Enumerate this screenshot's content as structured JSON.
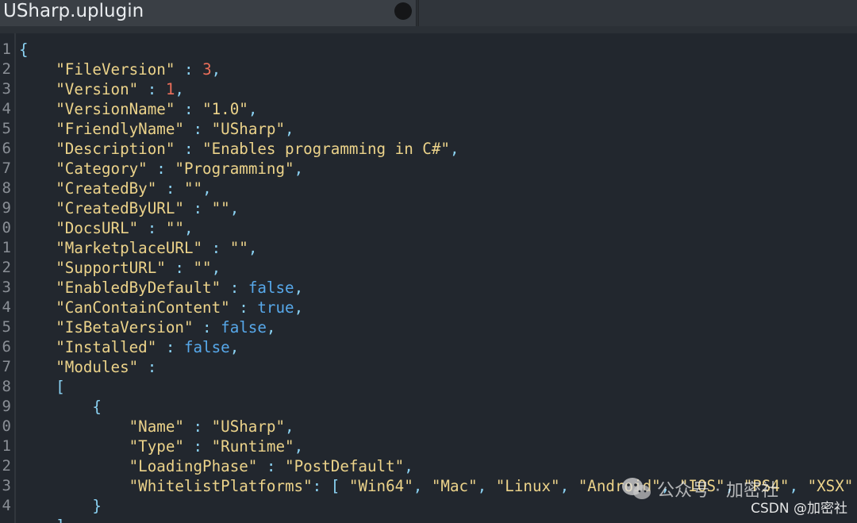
{
  "tab": {
    "title": "USharp.uplugin"
  },
  "editor": {
    "line_numbers": [
      "1",
      "2",
      "3",
      "4",
      "5",
      "6",
      "7",
      "8",
      "9",
      "0",
      "1",
      "2",
      "3",
      "4",
      "5",
      "6",
      "7",
      "8",
      "9",
      "0",
      "1",
      "2",
      "3",
      "4"
    ],
    "lines": [
      [
        {
          "t": "{",
          "c": "q"
        }
      ],
      [
        {
          "t": "    ",
          "c": ""
        },
        {
          "t": "\"FileVersion\"",
          "c": "k"
        },
        {
          "t": " : ",
          "c": "q"
        },
        {
          "t": "3",
          "c": "n"
        },
        {
          "t": ",",
          "c": "q"
        }
      ],
      [
        {
          "t": "    ",
          "c": ""
        },
        {
          "t": "\"Version\"",
          "c": "k"
        },
        {
          "t": " : ",
          "c": "q"
        },
        {
          "t": "1",
          "c": "n"
        },
        {
          "t": ",",
          "c": "q"
        }
      ],
      [
        {
          "t": "    ",
          "c": ""
        },
        {
          "t": "\"VersionName\"",
          "c": "k"
        },
        {
          "t": " : ",
          "c": "q"
        },
        {
          "t": "\"1.0\"",
          "c": "s"
        },
        {
          "t": ",",
          "c": "q"
        }
      ],
      [
        {
          "t": "    ",
          "c": ""
        },
        {
          "t": "\"FriendlyName\"",
          "c": "k"
        },
        {
          "t": " : ",
          "c": "q"
        },
        {
          "t": "\"USharp\"",
          "c": "s"
        },
        {
          "t": ",",
          "c": "q"
        }
      ],
      [
        {
          "t": "    ",
          "c": ""
        },
        {
          "t": "\"Description\"",
          "c": "k"
        },
        {
          "t": " : ",
          "c": "q"
        },
        {
          "t": "\"Enables programming in C#\"",
          "c": "s"
        },
        {
          "t": ",",
          "c": "q"
        }
      ],
      [
        {
          "t": "    ",
          "c": ""
        },
        {
          "t": "\"Category\"",
          "c": "k"
        },
        {
          "t": " : ",
          "c": "q"
        },
        {
          "t": "\"Programming\"",
          "c": "s"
        },
        {
          "t": ",",
          "c": "q"
        }
      ],
      [
        {
          "t": "    ",
          "c": ""
        },
        {
          "t": "\"CreatedBy\"",
          "c": "k"
        },
        {
          "t": " : ",
          "c": "q"
        },
        {
          "t": "\"\"",
          "c": "s"
        },
        {
          "t": ",",
          "c": "q"
        }
      ],
      [
        {
          "t": "    ",
          "c": ""
        },
        {
          "t": "\"CreatedByURL\"",
          "c": "k"
        },
        {
          "t": " : ",
          "c": "q"
        },
        {
          "t": "\"\"",
          "c": "s"
        },
        {
          "t": ",",
          "c": "q"
        }
      ],
      [
        {
          "t": "    ",
          "c": ""
        },
        {
          "t": "\"DocsURL\"",
          "c": "k"
        },
        {
          "t": " : ",
          "c": "q"
        },
        {
          "t": "\"\"",
          "c": "s"
        },
        {
          "t": ",",
          "c": "q"
        }
      ],
      [
        {
          "t": "    ",
          "c": ""
        },
        {
          "t": "\"MarketplaceURL\"",
          "c": "k"
        },
        {
          "t": " : ",
          "c": "q"
        },
        {
          "t": "\"\"",
          "c": "s"
        },
        {
          "t": ",",
          "c": "q"
        }
      ],
      [
        {
          "t": "    ",
          "c": ""
        },
        {
          "t": "\"SupportURL\"",
          "c": "k"
        },
        {
          "t": " : ",
          "c": "q"
        },
        {
          "t": "\"\"",
          "c": "s"
        },
        {
          "t": ",",
          "c": "q"
        }
      ],
      [
        {
          "t": "    ",
          "c": ""
        },
        {
          "t": "\"EnabledByDefault\"",
          "c": "k"
        },
        {
          "t": " : ",
          "c": "q"
        },
        {
          "t": "false",
          "c": "b"
        },
        {
          "t": ",",
          "c": "q"
        }
      ],
      [
        {
          "t": "    ",
          "c": ""
        },
        {
          "t": "\"CanContainContent\"",
          "c": "k"
        },
        {
          "t": " : ",
          "c": "q"
        },
        {
          "t": "true",
          "c": "b"
        },
        {
          "t": ",",
          "c": "q"
        }
      ],
      [
        {
          "t": "    ",
          "c": ""
        },
        {
          "t": "\"IsBetaVersion\"",
          "c": "k"
        },
        {
          "t": " : ",
          "c": "q"
        },
        {
          "t": "false",
          "c": "b"
        },
        {
          "t": ",",
          "c": "q"
        }
      ],
      [
        {
          "t": "    ",
          "c": ""
        },
        {
          "t": "\"Installed\"",
          "c": "k"
        },
        {
          "t": " : ",
          "c": "q"
        },
        {
          "t": "false",
          "c": "b"
        },
        {
          "t": ",",
          "c": "q"
        }
      ],
      [
        {
          "t": "    ",
          "c": ""
        },
        {
          "t": "\"Modules\"",
          "c": "k"
        },
        {
          "t": " :",
          "c": "q"
        }
      ],
      [
        {
          "t": "    ",
          "c": ""
        },
        {
          "t": "[",
          "c": "q"
        }
      ],
      [
        {
          "t": "        ",
          "c": ""
        },
        {
          "t": "{",
          "c": "q"
        }
      ],
      [
        {
          "t": "            ",
          "c": ""
        },
        {
          "t": "\"Name\"",
          "c": "k"
        },
        {
          "t": " : ",
          "c": "q"
        },
        {
          "t": "\"USharp\"",
          "c": "s"
        },
        {
          "t": ",",
          "c": "q"
        }
      ],
      [
        {
          "t": "            ",
          "c": ""
        },
        {
          "t": "\"Type\"",
          "c": "k"
        },
        {
          "t": " : ",
          "c": "q"
        },
        {
          "t": "\"Runtime\"",
          "c": "s"
        },
        {
          "t": ",",
          "c": "q"
        }
      ],
      [
        {
          "t": "            ",
          "c": ""
        },
        {
          "t": "\"LoadingPhase\"",
          "c": "k"
        },
        {
          "t": " : ",
          "c": "q"
        },
        {
          "t": "\"PostDefault\"",
          "c": "s"
        },
        {
          "t": ",",
          "c": "q"
        }
      ],
      [
        {
          "t": "            ",
          "c": ""
        },
        {
          "t": "\"WhitelistPlatforms\"",
          "c": "k"
        },
        {
          "t": ": [ ",
          "c": "q"
        },
        {
          "t": "\"Win64\"",
          "c": "s"
        },
        {
          "t": ", ",
          "c": "q"
        },
        {
          "t": "\"Mac\"",
          "c": "s"
        },
        {
          "t": ", ",
          "c": "q"
        },
        {
          "t": "\"Linux\"",
          "c": "s"
        },
        {
          "t": ", ",
          "c": "q"
        },
        {
          "t": "\"Android\"",
          "c": "s"
        },
        {
          "t": ", ",
          "c": "q"
        },
        {
          "t": "\"IOS\"",
          "c": "s"
        },
        {
          "t": ", ",
          "c": "q"
        },
        {
          "t": "\"PS4\"",
          "c": "s"
        },
        {
          "t": ", ",
          "c": "q"
        },
        {
          "t": "\"XSX\"",
          "c": "s"
        }
      ],
      [
        {
          "t": "        ",
          "c": ""
        },
        {
          "t": "}",
          "c": "q"
        }
      ],
      [
        {
          "t": "    ",
          "c": ""
        },
        {
          "t": "]",
          "c": "q"
        }
      ]
    ]
  },
  "watermark": {
    "label": "公众号 · 加密社",
    "credit": "CSDN @加密社"
  },
  "colors": {
    "background": "#22272e",
    "key": "#ecd38a",
    "string": "#ecd38a",
    "number": "#ec6f5a",
    "boolean": "#57a8ea",
    "punctuation": "#8bd3f4",
    "line_number": "#8a8f96"
  }
}
